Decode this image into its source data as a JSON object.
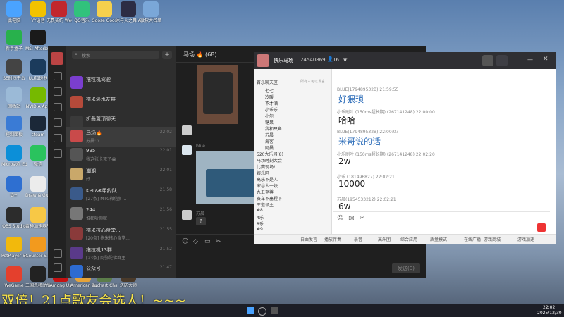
{
  "desktop": {
    "icons": [
      {
        "label": "此电脑",
        "color": "#4aa3ff"
      },
      {
        "label": "YY语音",
        "color": "#f2c200"
      },
      {
        "label": "无畏契约\nWeGame版",
        "color": "#c1272d"
      },
      {
        "label": "QQ音乐",
        "color": "#31c27c"
      },
      {
        "label": "Goose Goose Duck",
        "color": "#f5d04d"
      },
      {
        "label": "冰与火之舞 A Dance of F...",
        "color": "#2c2c44"
      },
      {
        "label": "微软大名单",
        "color": "#7aa7d8"
      },
      {
        "label": "新手盒子",
        "color": "#28b14c"
      },
      {
        "label": "MSI Afterburner",
        "color": "#1a1a1a"
      },
      {
        "label": "SE时间平台",
        "color": "#444"
      },
      {
        "label": "UU加速器",
        "color": "#1b3b5c"
      },
      {
        "label": "回收站",
        "color": "#9bbad7"
      },
      {
        "label": "NVIDIA App",
        "color": "#76b900"
      },
      {
        "label": "控制面板",
        "color": "#3a7bd5"
      },
      {
        "label": "steam",
        "color": "#1b2838"
      },
      {
        "label": "Microsoft Edge",
        "color": "#0c8fd8"
      },
      {
        "label": "微信",
        "color": "#2ac35e"
      },
      {
        "label": "G+",
        "color": "#2e6fd1"
      },
      {
        "label": "Draw & Guess",
        "color": "#ececec"
      },
      {
        "label": "OBS Studio",
        "color": "#2c2c2c"
      },
      {
        "label": "雷神加速器平台",
        "color": "#f7c846"
      },
      {
        "label": "PotPlayer 64 bit",
        "color": "#f2b90c"
      },
      {
        "label": "Counter-S...",
        "color": "#f29a1e"
      },
      {
        "label": "WeGame",
        "color": "#e4402d"
      },
      {
        "label": "三国杀移动版平台",
        "color": "#222"
      },
      {
        "label": "Among Us",
        "color": "#c51111"
      },
      {
        "label": "American Arcadia",
        "color": "#e5a33a"
      },
      {
        "label": "Suchart Challenge",
        "color": "#5b7d4a"
      },
      {
        "label": "塔防大师",
        "color": "#4a3a2a"
      }
    ]
  },
  "wechat": {
    "search_placeholder": "搜索",
    "chat_title": "马场 🔥 (68)",
    "send_label": "发送(S)",
    "chats": [
      {
        "name": "拖粒机驾驶",
        "preview": "",
        "time": "",
        "color": "#7a3ecf"
      },
      {
        "name": "拖米褒水友群",
        "preview": "",
        "time": "",
        "color": "#b54a3a"
      },
      {
        "name": "折叠置顶聊天",
        "preview": "",
        "time": "",
        "color": "#3a3a3a"
      },
      {
        "name": "马场🔥",
        "preview": "苏晨: ?",
        "time": "22:02",
        "color": "#c94a4a"
      },
      {
        "name": "995",
        "preview": "我这张卡死了😂",
        "time": "22:01",
        "color": "#555"
      },
      {
        "name": "潮潮",
        "preview": "好",
        "time": "22:01",
        "color": "#c9a86a"
      },
      {
        "name": "KPL&K甲约队...",
        "preview": "[27条] MTG微信扩...",
        "time": "21:58",
        "color": "#3a5a8a"
      },
      {
        "name": "244",
        "preview": "谁都听你呢",
        "time": "21:56",
        "color": "#777"
      },
      {
        "name": "拖米核心食堂...",
        "preview": "[20条] 拖米核心食堂...",
        "time": "21:55",
        "color": "#8a3a3a"
      },
      {
        "name": "拖拉机13群",
        "preview": "[23条] 阿弥陀佛群主...",
        "time": "21:52",
        "color": "#5a3a8a"
      },
      {
        "name": "公众号",
        "preview": "",
        "time": "21:47",
        "color": "#2d6bd1"
      }
    ],
    "messages": [
      {
        "sender": "blue",
        "type": "image"
      },
      {
        "sender": "苏晨",
        "text": "?"
      }
    ]
  },
  "yy": {
    "channel_name": "快乐马场",
    "channel_id": "24540869",
    "online_count": "16",
    "tabs": [
      "首乐聊天区",
      "所有人可以发言"
    ],
    "channels": [
      "七七二",
      "冷暖",
      "不才酒",
      "小乐乐",
      "小尔",
      "糖果",
      "我和只鱼",
      "苏晨",
      "海客",
      "阿晨",
      "520大乐园(8)",
      "马场时刻大会",
      "比赛现场!",
      "娱乐区",
      "高乐不是人",
      "宋谷人一块",
      "九五至尊",
      "赛车不塞程下",
      "王道领主",
      "#8",
      "4乐",
      "8乐",
      "#9"
    ],
    "chat": [
      {
        "head": "BLUE(179489532B) 21:59:55",
        "body": "好猥琐",
        "blue": true
      },
      {
        "head": "小乐刷叶 (150ms超长期) (267141248) 22:00:00",
        "body": "哈哈",
        "blue": false
      },
      {
        "head": "BLUE(179489532B) 22:00:07",
        "body": "米哥说的话",
        "blue": true
      },
      {
        "head": "小乐刷叶 (150ms超长期) (267141248) 22:02:20",
        "body": "2w",
        "blue": false
      },
      {
        "head": "小乐 (181496827) 22:02:21",
        "body": "10000",
        "blue": false
      },
      {
        "head": "苏晨(1954533212) 22:02:21",
        "body": "6w",
        "blue": false
      }
    ],
    "input_placeholder": "",
    "bottom_buttons": [
      "自由发言",
      "播放伴奏",
      "录音",
      "高乐团",
      "综合应用",
      "质量模式",
      "在线广播",
      "游戏商城",
      "游戏加速"
    ]
  },
  "banner_text": "双倍！21点歌友会选人！~~~",
  "taskbar": {
    "time": "22:02",
    "date": "2025/12/30"
  }
}
